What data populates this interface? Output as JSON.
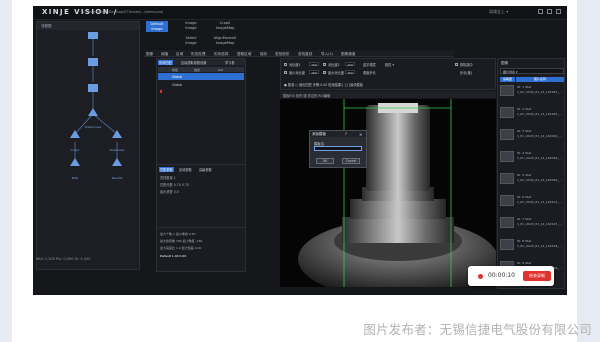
{
  "app": {
    "brand": "XINJE VISION /",
    "file_path": "C:/Users/yuqh/Desktop/S7/tubes/.../demo.proj",
    "title_right": "局域全上 ▾"
  },
  "flow": {
    "header": "流程图",
    "nodes": [
      {
        "label": ""
      },
      {
        "label": ""
      },
      {
        "label": ""
      },
      {
        "label": "Preprocess"
      },
      {
        "label": "Crop1"
      },
      {
        "label": "Features0"
      },
      {
        "label": "Blob"
      },
      {
        "label": "Results"
      }
    ],
    "footer": "Wid: 1,200  Pix: 0,000  Hi: 4,000"
  },
  "tabs": [
    {
      "label": "Default\nImage",
      "active": true
    },
    {
      "label": "Image\nImage",
      "active": false
    },
    {
      "label": "Crop0\nImageMap",
      "active": false
    },
    {
      "label": "Select\nImage",
      "active": false
    },
    {
      "label": "AlignParam0\nImageMap",
      "active": false
    }
  ],
  "menu": [
    "图像",
    "阈值",
    "区域",
    "形态处理",
    "形状选择",
    "提取区域",
    "保存",
    "查找矩形",
    "查找直线",
    "导入(1)",
    "图像通道"
  ],
  "params": {
    "tabs": [
      {
        "label": "形状匹配",
        "active": true
      },
      {
        "label": "边缘提取参数设置",
        "active": false
      },
      {
        "label": "学习参",
        "active": false
      }
    ],
    "header": [
      "",
      "模板",
      "描述",
      "Ref"
    ],
    "rows": [
      {
        "cells": [
          "",
          "Global",
          "",
          ""
        ],
        "selected": true
      },
      {
        "cells": [
          "",
          "Global",
          "",
          ""
        ],
        "selected": false
      },
      {
        "cells": [
          "",
          "",
          "",
          ""
        ],
        "selected": false
      }
    ],
    "sub_tabs": [
      {
        "label": "匹配参数",
        "active": true
      },
      {
        "label": "区域参数",
        "active": false
      },
      {
        "label": "高级参数",
        "active": false
      }
    ],
    "sub_lines": [
      "查找数量   1",
      "匹配分数  0.70  0.70",
      "最大重叠  0.5"
    ],
    "bottom_lines": [
      "最大个数  1       最小重叠  0.50",
      "最大搜索角 180     最小角度 -180",
      "最大亮度比 1.0     最大色差 0.00",
      "Default  1.00      0.00"
    ]
  },
  "options": {
    "rows": [
      [
        {
          "label": "对比度1",
          "value": "150"
        },
        {
          "label": "对比度2",
          "value": "150"
        },
        {
          "label": "金字塔层",
          "value": ""
        },
        {
          "label": "极性 ▾",
          "value": ""
        },
        {
          "label": "排除选中",
          "value": ""
        }
      ],
      [
        {
          "label": "最小对比度",
          "value": "150"
        },
        {
          "label": "最大对比度",
          "value": "150"
        },
        {
          "label": "角度步长",
          "value": ""
        },
        {
          "label": "步长(度)",
          "value": ""
        }
      ]
    ],
    "mode_label": "● 基准  ○ 最优匹配    步骤:0.00    检测结果:[ ]    [ ]最优模板"
  },
  "image_bar": "模板ROI  矩形  圆  多边形    ROI编辑",
  "right_panel": {
    "title": "图像",
    "combo": "图片列表 ▾",
    "headers": [
      "缩略图",
      "图片名称"
    ],
    "items": [
      {
        "line1": "ID: 1    Stat",
        "line2": "1_Pic_2020_03_14_161925_..."
      },
      {
        "line1": "ID: 2    Stat",
        "line2": "1_Pic_2020_03_14_161935_..."
      },
      {
        "line1": "ID: 3    Stat",
        "line2": "1_Pic_2020_03_14_162006_..."
      },
      {
        "line1": "ID: 4    Stat",
        "line2": "1_Pic_2020_03_14_162028_..."
      },
      {
        "line1": "ID: 5    Stat",
        "line2": "1_Pic_2020_03_14_162049_..."
      },
      {
        "line1": "ID: 6    Stat",
        "line2": "1_Pic_2020_03_14_162103_..."
      },
      {
        "line1": "ID: 7    Stat",
        "line2": "1_Pic_2020_03_14_162125_..."
      },
      {
        "line1": "ID: 8    Stat",
        "line2": "1_Pic_2020_03_14_162148_..."
      },
      {
        "line1": "ID: 9    Stat",
        "line2": "1_Pic_2020_03_14_162206_..."
      }
    ]
  },
  "dialog": {
    "title": "添加模板",
    "help": "?",
    "close": "×",
    "label": "模板名:",
    "input_value": "",
    "ok": "OK",
    "cancel": "Cancel"
  },
  "recording": {
    "time": "00:00:10",
    "stop_label": "结束录制"
  },
  "caption": "图片发布者：无锡信捷电气股份有限公司",
  "colors": {
    "accent": "#2f6fd1",
    "roi_green": "#35c85a",
    "rec_red": "#e0332f"
  }
}
